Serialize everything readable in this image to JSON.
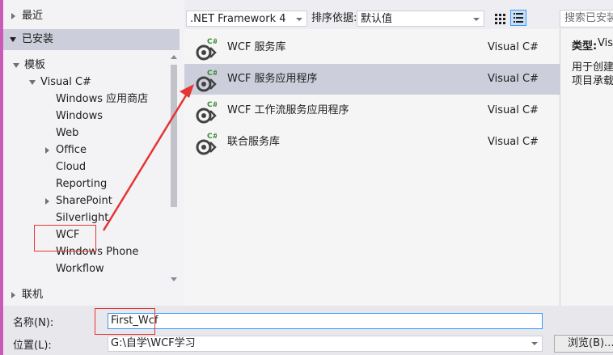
{
  "tree": {
    "recent": "最近",
    "installed": "已安装",
    "templates": "模板",
    "visual_csharp": "Visual C#",
    "items": [
      "Windows 应用商店",
      "Windows",
      "Web",
      "Office",
      "Cloud",
      "Reporting",
      "SharePoint",
      "Silverlight",
      "WCF",
      "Windows Phone",
      "Workflow"
    ],
    "online": "联机"
  },
  "toolbar": {
    "framework": ".NET Framework 4",
    "sort_label": "排序依据:",
    "sort_value": "默认值",
    "search_placeholder": "搜索已安装"
  },
  "templates": [
    {
      "name": "WCF 服务库",
      "lang": "Visual C#"
    },
    {
      "name": "WCF 服务应用程序",
      "lang": "Visual C#"
    },
    {
      "name": "WCF 工作流服务应用程序",
      "lang": "Visual C#"
    },
    {
      "name": "联合服务库",
      "lang": "Visual C#"
    }
  ],
  "details": {
    "type_label": "类型:",
    "type_value": "Vis",
    "desc_line1": "用于创建",
    "desc_line2": "项目承载("
  },
  "form": {
    "name_label": "名称(N):",
    "name_value": "First_Wcf",
    "location_label": "位置(L):",
    "location_value": "G:\\自学\\WCF学习",
    "browse_label": "浏览(B)..."
  },
  "icon_badge": "C#",
  "colors": {
    "selection": "#cccedb",
    "accent_border": "#3399ff",
    "annotation_red": "#e53535",
    "frame_pink": "#cd59b6"
  }
}
